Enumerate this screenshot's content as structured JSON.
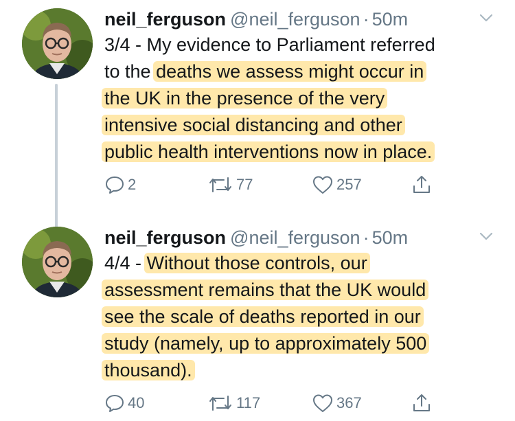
{
  "thread": {
    "tweets": [
      {
        "name": "neil_ferguson",
        "handle": "@neil_ferguson",
        "separator": "·",
        "time": "50m",
        "lines": [
          {
            "plain": "3/4 - My evidence to Parliament referred",
            "highlight": ""
          },
          {
            "plain": "to the ",
            "highlight": "deaths we assess might occur in"
          },
          {
            "plain": "",
            "highlight": "the UK in the presence of the very"
          },
          {
            "plain": "",
            "highlight": "intensive social distancing and other"
          },
          {
            "plain": "",
            "highlight": "public health interventions now in place."
          }
        ],
        "reply_count": "2",
        "retweet_count": "77",
        "like_count": "257"
      },
      {
        "name": "neil_ferguson",
        "handle": "@neil_ferguson",
        "separator": "·",
        "time": "50m",
        "lines": [
          {
            "plain": "4/4 - ",
            "highlight": "Without those controls, our"
          },
          {
            "plain": "",
            "highlight": "assessment remains that the UK would"
          },
          {
            "plain": "",
            "highlight": "see the scale of deaths reported in our"
          },
          {
            "plain": "",
            "highlight": "study (namely, up to approximately 500"
          },
          {
            "plain": "",
            "highlight": "thousand)."
          }
        ],
        "reply_count": "40",
        "retweet_count": "117",
        "like_count": "367"
      }
    ]
  },
  "icons": {
    "reply": "reply-icon",
    "retweet": "retweet-icon",
    "like": "heart-icon",
    "share": "share-icon",
    "menu": "chevron-down-icon"
  },
  "colors": {
    "text": "#14171a",
    "secondary": "#657786",
    "highlight": "#ffd666",
    "thread_line": "#c7d0d8"
  }
}
